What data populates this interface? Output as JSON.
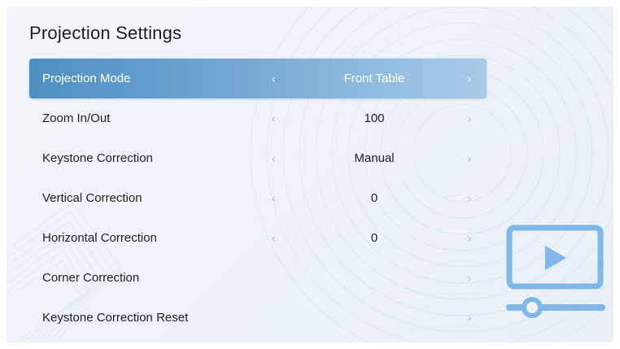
{
  "page": {
    "title": "Projection Settings"
  },
  "menu": {
    "items": [
      {
        "label": "Projection Mode",
        "value": "Front Table",
        "has_left": true,
        "has_right": true,
        "selected": true
      },
      {
        "label": "Zoom In/Out",
        "value": "100",
        "has_left": true,
        "has_right": true,
        "selected": false
      },
      {
        "label": "Keystone Correction",
        "value": "Manual",
        "has_left": true,
        "has_right": true,
        "selected": false
      },
      {
        "label": "Vertical Correction",
        "value": "0",
        "has_left": true,
        "has_right": true,
        "selected": false
      },
      {
        "label": "Horizontal Correction",
        "value": "0",
        "has_left": true,
        "has_right": true,
        "selected": false
      },
      {
        "label": "Corner Correction",
        "value": "",
        "has_left": false,
        "has_right": true,
        "selected": false
      },
      {
        "label": "Keystone Correction Reset",
        "value": "",
        "has_left": false,
        "has_right": true,
        "selected": false
      }
    ],
    "arrow_left_glyph": "‹",
    "arrow_right_glyph": "›"
  },
  "hero": {
    "icon": "video-player-icon",
    "color": "#7fb8e6"
  },
  "colors": {
    "accent": "#5a98c8",
    "text": "#1e1e22",
    "arrow": "#a8c2da"
  }
}
